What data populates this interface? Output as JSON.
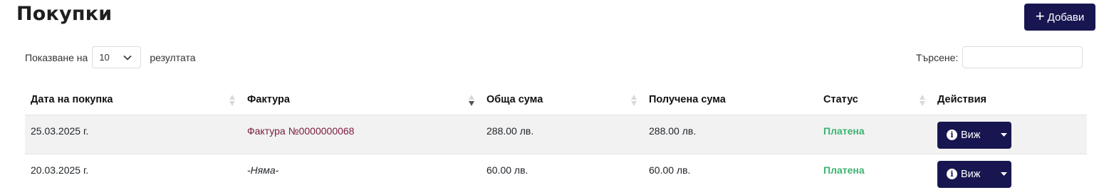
{
  "header": {
    "title": "Покупки",
    "add_label": "Добави"
  },
  "controls": {
    "length_prefix": "Показване на",
    "length_value": "10",
    "length_suffix": "резултата",
    "search_label": "Търсене:",
    "search_value": ""
  },
  "table": {
    "columns": [
      "Дата на покупка",
      "Фактура",
      "Обща сума",
      "Получена сума",
      "Статус",
      "Действия"
    ],
    "rows": [
      {
        "date": "25.03.2025 г.",
        "invoice": "Фактура №0000000068",
        "total": "288.00 лв.",
        "received": "288.00 лв.",
        "status": "Платена",
        "action": "Виж"
      },
      {
        "date": "20.03.2025 г.",
        "invoice": "-Няма-",
        "total": "60.00 лв.",
        "received": "60.00 лв.",
        "status": "Платена",
        "action": "Виж"
      }
    ]
  },
  "colors": {
    "primary": "#181650",
    "link": "#7a1a3e",
    "paid": "#3cb371",
    "stripe": "#f2f2f2"
  },
  "icons": {
    "add": "plus-icon",
    "view": "info-icon",
    "dropdown": "caret-down-icon",
    "sort": "sort-icon",
    "sort_active": "sort-desc-icon"
  }
}
